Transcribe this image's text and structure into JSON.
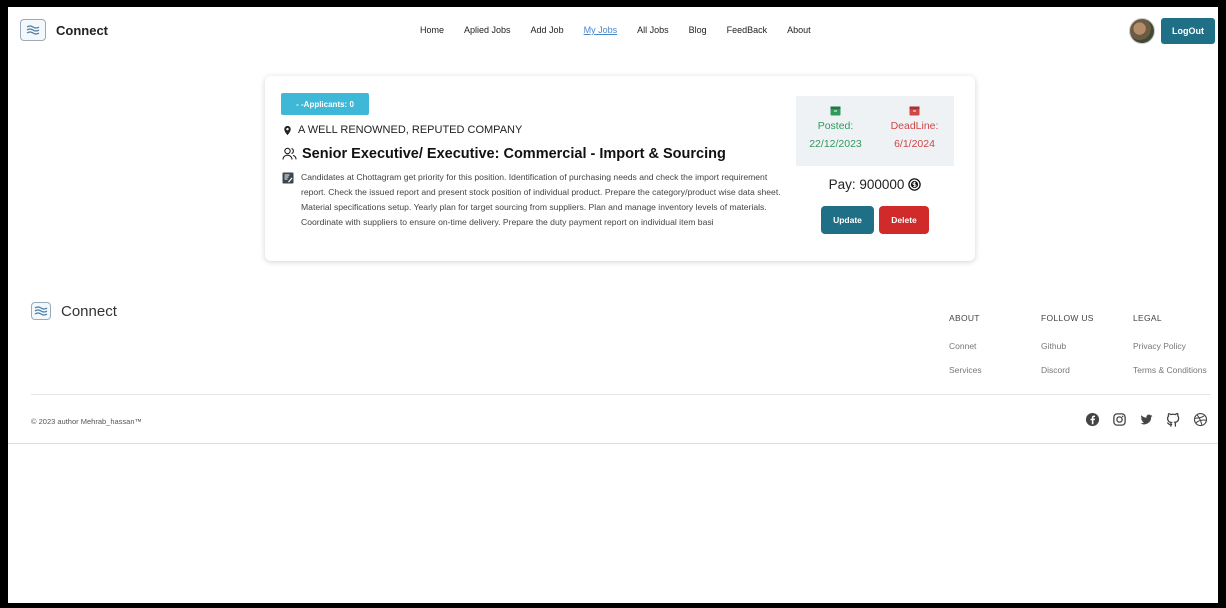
{
  "navbar": {
    "brand": "Connect",
    "links": [
      "Home",
      "Aplied Jobs",
      "Add Job",
      "My Jobs",
      "All Jobs",
      "Blog",
      "FeedBack",
      "About"
    ],
    "active_link": "My Jobs",
    "logout_label": "LogOut"
  },
  "job": {
    "applicants_label": "- -Applicants: 0",
    "company": "A WELL RENOWNED, REPUTED COMPANY",
    "title": "Senior Executive/ Executive: Commercial - Import & Sourcing",
    "description": "Candidates at Chottagram get priority for this position. Identification of purchasing needs and check the import requirement report. Check the issued report and present stock position of individual product. Prepare the category/product wise data sheet. Material specifications setup. Yearly plan for target sourcing from suppliers. Plan and manage inventory levels of materials. Coordinate with suppliers to ensure on-time delivery. Prepare the duty payment report on individual item basi",
    "posted_label": "Posted:",
    "posted_date": "22/12/2023",
    "deadline_label": "DeadLine:",
    "deadline_date": "6/1/2024",
    "pay_label": "Pay: 900000",
    "update_label": "Update",
    "delete_label": "Delete"
  },
  "footer": {
    "brand": "Connect",
    "columns": [
      {
        "heading": "ABOUT",
        "links": [
          "Connet",
          "Services"
        ]
      },
      {
        "heading": "FOLLOW US",
        "links": [
          "Github",
          "Discord"
        ]
      },
      {
        "heading": "LEGAL",
        "links": [
          "Privacy Policy",
          "Terms & Conditions"
        ]
      }
    ],
    "copyright": "© 2023 author Mehrab_hassan™",
    "socials": [
      "facebook-icon",
      "instagram-icon",
      "twitter-icon",
      "github-icon",
      "dribbble-icon"
    ]
  },
  "colors": {
    "primary": "#1f6f86",
    "danger": "#d02a2a",
    "info": "#3fb7d6",
    "posted": "#2f9a5c",
    "deadline": "#d04646"
  }
}
